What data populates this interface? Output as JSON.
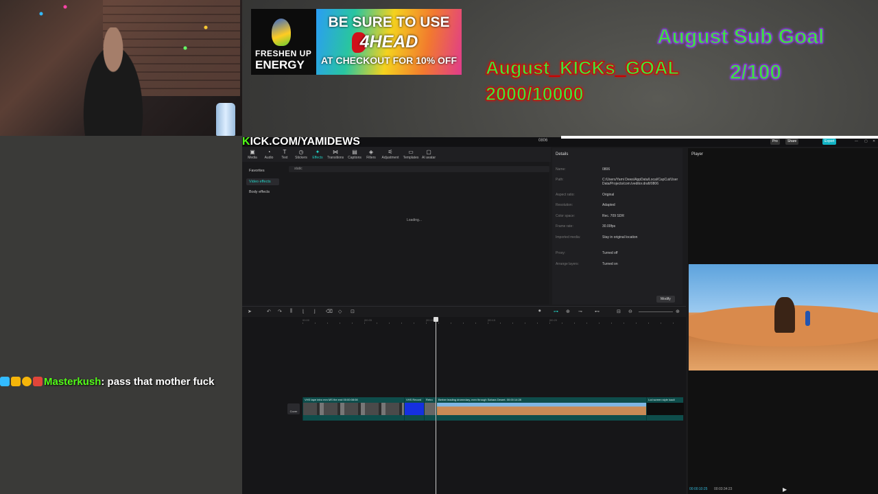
{
  "stream": {
    "ad": {
      "brand_line1": "FRESHEN UP",
      "brand_line2": "ENERGY",
      "line1": "BE SURE TO USE",
      "line2": "4HEAD",
      "line3": "AT CHECKOUT FOR 10% OFF"
    },
    "kicks_goal": {
      "label": "August_KICKs_GOAL",
      "value": "2000/10000"
    },
    "sub_goal": {
      "label": "August Sub Goal",
      "value": "2/100"
    },
    "channel": {
      "k": "K",
      "rest": "ICK.COM/YAMIDEWS"
    },
    "chat": {
      "user": "Masterkush",
      "message": "pass that mother fuck"
    }
  },
  "app": {
    "project_name": "0806",
    "titlebar_buttons": [
      "Pro",
      "Share",
      "Export"
    ],
    "tools": [
      {
        "label": "Media",
        "icon": "▣"
      },
      {
        "label": "Audio",
        "icon": "◔"
      },
      {
        "label": "Text",
        "icon": "T"
      },
      {
        "label": "Stickers",
        "icon": "◷"
      },
      {
        "label": "Effects",
        "icon": "✦"
      },
      {
        "label": "Transitions",
        "icon": "⋈"
      },
      {
        "label": "Captions",
        "icon": "▤"
      },
      {
        "label": "Filters",
        "icon": "◈"
      },
      {
        "label": "Adjustment",
        "icon": "⚟"
      },
      {
        "label": "Templates",
        "icon": "▭"
      },
      {
        "label": "AI avatar",
        "icon": "▢"
      }
    ],
    "effects_sidebar": [
      "Favorites",
      "Video effects",
      "Body effects"
    ],
    "search_value": "static",
    "loading_text": "Loading...",
    "details": {
      "header": "Details",
      "rows": [
        {
          "k": "Name:",
          "v": "0806"
        },
        {
          "k": "Path:",
          "v": "C:/Users/Yami Dews/AppData/Local/CapCut/User Data/Projects/com.lveditor.draft/0806"
        },
        {
          "k": "Aspect ratio:",
          "v": "Original"
        },
        {
          "k": "Resolution:",
          "v": "Adapted"
        },
        {
          "k": "Color space:",
          "v": "Rec. 709 SDR"
        },
        {
          "k": "Frame rate:",
          "v": "30.00fps"
        },
        {
          "k": "Imported media:",
          "v": "Stay in original location"
        },
        {
          "k": "Proxy:",
          "v": "Turned off"
        },
        {
          "k": "Arrange layers:",
          "v": "Turned on"
        }
      ],
      "modify_label": "Modify"
    },
    "player": {
      "header": "Player",
      "current_time": "00:00:10:25",
      "total_time": "00:03:34:23"
    },
    "timeline": {
      "ruler_labels": [
        "00:00",
        "|00:05",
        "|00:10",
        "|00:15",
        "|00:20"
      ],
      "cover_label": "Cover",
      "clips": [
        {
          "label": "VHS tape intro mm MS the end   00:00:08:08",
          "color": "#3a3a3a"
        },
        {
          "label": "VHS Record",
          "color": "#1530e0"
        },
        {
          "label": "Retro",
          "color": "#555"
        },
        {
          "label": "Berber leading dromedary, men through Sahara Desert.   00:00:14:28",
          "color": "#c98a55"
        },
        {
          "label": "Lcd screen style loadi",
          "color": "#111"
        }
      ]
    }
  }
}
